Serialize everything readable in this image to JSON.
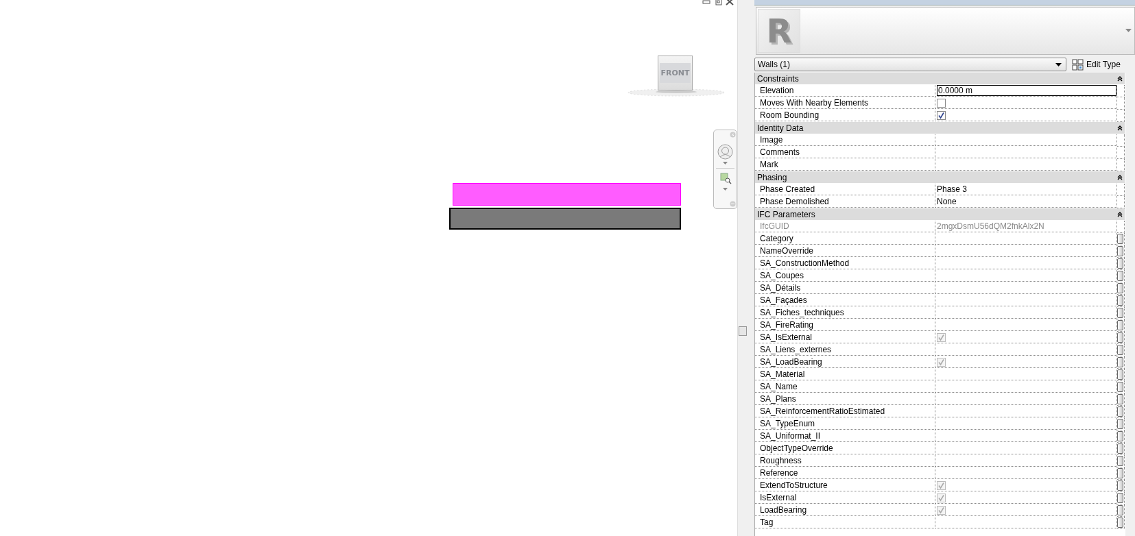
{
  "view": {
    "viewcube_label": "FRONT"
  },
  "properties": {
    "logo_letter": "R",
    "type_selector": "Walls (1)",
    "edit_type": "Edit Type",
    "groups": [
      {
        "title": "Constraints",
        "expanded": true,
        "rows": [
          {
            "name": "Elevation",
            "kind": "text",
            "value": "0.0000 m",
            "editing": true,
            "disabled": false,
            "button": false
          },
          {
            "name": "Moves With Nearby Elements",
            "kind": "checkbox",
            "checked": false,
            "disabled": false,
            "button": false
          },
          {
            "name": "Room Bounding",
            "kind": "checkbox",
            "checked": true,
            "disabled": false,
            "button": false
          }
        ]
      },
      {
        "title": "Identity Data",
        "expanded": true,
        "rows": [
          {
            "name": "Image",
            "kind": "text",
            "editing": false,
            "disabled": false,
            "button": false
          },
          {
            "name": "Comments",
            "kind": "text",
            "editing": false,
            "disabled": false,
            "button": false
          },
          {
            "name": "Mark",
            "kind": "text",
            "editing": false,
            "disabled": false,
            "button": false
          }
        ]
      },
      {
        "title": "Phasing",
        "expanded": true,
        "rows": [
          {
            "name": "Phase Created",
            "kind": "text",
            "value": "Phase 3",
            "editing": false,
            "disabled": false,
            "button": false
          },
          {
            "name": "Phase Demolished",
            "kind": "text",
            "value": "None",
            "editing": false,
            "disabled": false,
            "button": false
          }
        ]
      },
      {
        "title": "IFC Parameters",
        "expanded": true,
        "rows": [
          {
            "name": "IfcGUID",
            "kind": "text",
            "value": "2mgxDsmU56dQM2fnkAlx2N",
            "editing": false,
            "disabled": true,
            "button": false
          },
          {
            "name": "Category",
            "kind": "text",
            "editing": false,
            "disabled": false,
            "button": true
          },
          {
            "name": "NameOverride",
            "kind": "text",
            "editing": false,
            "disabled": false,
            "button": true
          },
          {
            "name": "SA_ConstructionMethod",
            "kind": "text",
            "editing": false,
            "disabled": false,
            "button": true
          },
          {
            "name": "SA_Coupes",
            "kind": "text",
            "editing": false,
            "disabled": false,
            "button": true
          },
          {
            "name": "SA_Détails",
            "kind": "text",
            "editing": false,
            "disabled": false,
            "button": true
          },
          {
            "name": "SA_Façades",
            "kind": "text",
            "editing": false,
            "disabled": false,
            "button": true
          },
          {
            "name": "SA_Fiches_techniques",
            "kind": "text",
            "editing": false,
            "disabled": false,
            "button": true
          },
          {
            "name": "SA_FireRating",
            "kind": "text",
            "editing": false,
            "disabled": false,
            "button": true
          },
          {
            "name": "SA_IsExternal",
            "kind": "checkbox",
            "checked": true,
            "disabled": true,
            "button": true
          },
          {
            "name": "SA_Liens_externes",
            "kind": "text",
            "editing": false,
            "disabled": false,
            "button": true
          },
          {
            "name": "SA_LoadBearing",
            "kind": "checkbox",
            "checked": true,
            "disabled": true,
            "button": true
          },
          {
            "name": "SA_Material",
            "kind": "text",
            "editing": false,
            "disabled": false,
            "button": true
          },
          {
            "name": "SA_Name",
            "kind": "text",
            "editing": false,
            "disabled": false,
            "button": true
          },
          {
            "name": "SA_Plans",
            "kind": "text",
            "editing": false,
            "disabled": false,
            "button": true
          },
          {
            "name": "SA_ReinforcementRatioEstimated",
            "kind": "text",
            "editing": false,
            "disabled": false,
            "button": true
          },
          {
            "name": "SA_TypeEnum",
            "kind": "text",
            "editing": false,
            "disabled": false,
            "button": true
          },
          {
            "name": "SA_Uniformat_II",
            "kind": "text",
            "editing": false,
            "disabled": false,
            "button": true
          },
          {
            "name": "ObjectTypeOverride",
            "kind": "text",
            "editing": false,
            "disabled": false,
            "button": true
          },
          {
            "name": "Roughness",
            "kind": "text",
            "editing": false,
            "disabled": false,
            "button": true
          },
          {
            "name": "Reference",
            "kind": "text",
            "editing": false,
            "disabled": false,
            "button": true
          },
          {
            "name": "ExtendToStructure",
            "kind": "checkbox",
            "checked": true,
            "disabled": true,
            "button": true
          },
          {
            "name": "IsExternal",
            "kind": "checkbox",
            "checked": true,
            "disabled": true,
            "button": true
          },
          {
            "name": "LoadBearing",
            "kind": "checkbox",
            "checked": true,
            "disabled": true,
            "button": true
          },
          {
            "name": "Tag",
            "kind": "text",
            "editing": false,
            "disabled": false,
            "button": true
          }
        ]
      }
    ]
  }
}
